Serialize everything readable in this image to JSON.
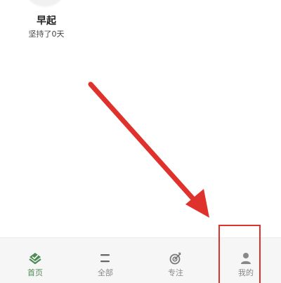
{
  "habit": {
    "name": "早起",
    "streak": "坚持了0天"
  },
  "tabbar": {
    "active_color": "#4f8a55",
    "inactive_color": "#888888",
    "items": [
      {
        "label": "首页",
        "icon": "home-check-icon"
      },
      {
        "label": "全部",
        "icon": "list-lines-icon"
      },
      {
        "label": "专注",
        "icon": "target-icon"
      },
      {
        "label": "我的",
        "icon": "person-icon"
      }
    ]
  },
  "annotation": {
    "color": "#e0322c"
  }
}
